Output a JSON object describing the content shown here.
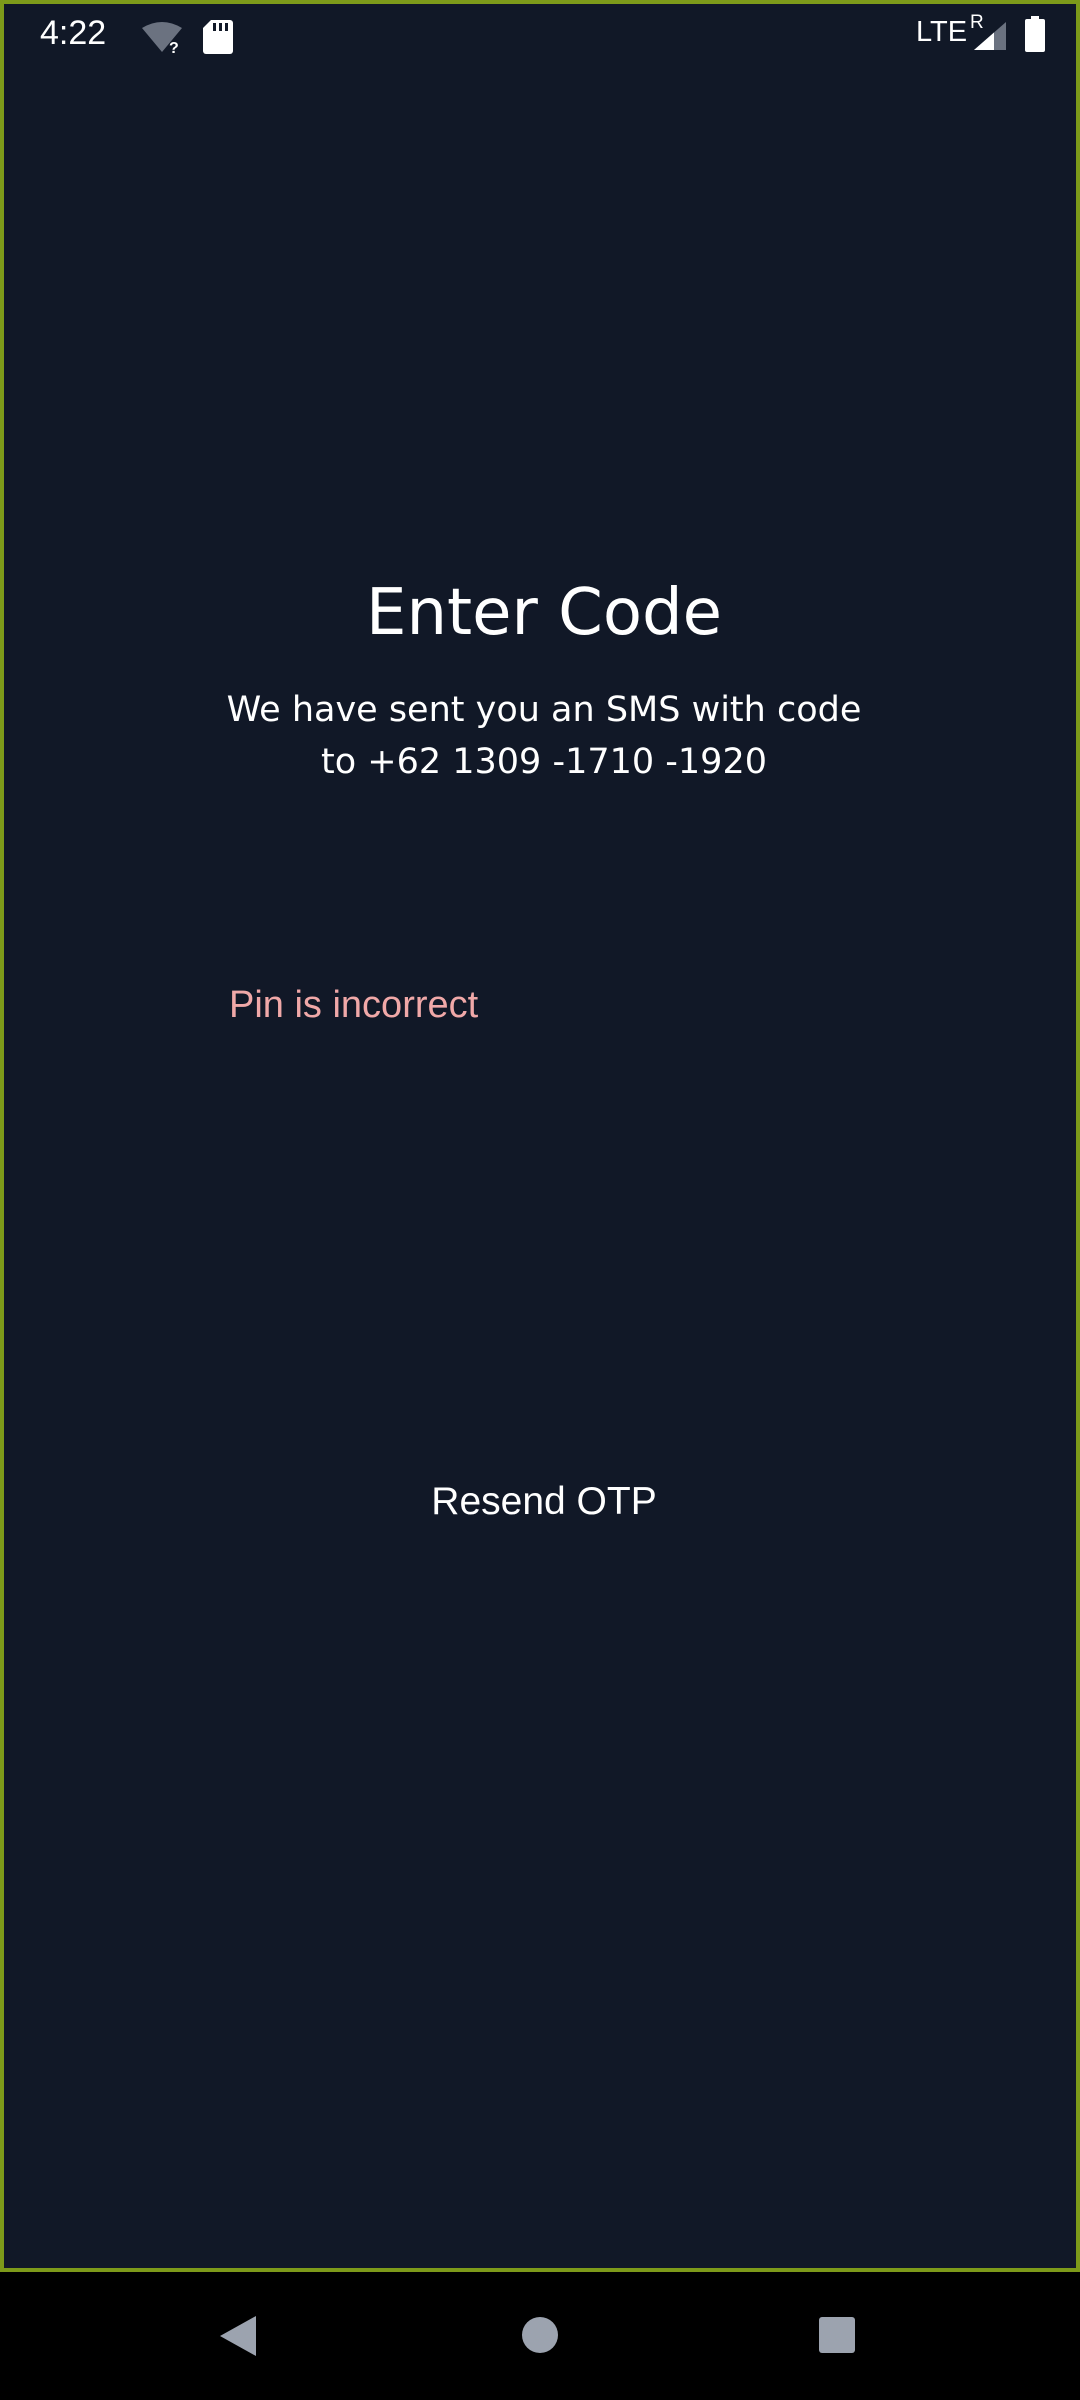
{
  "status_bar": {
    "time": "4:22",
    "network": "LTE",
    "roaming": "R",
    "icons": [
      "wifi-unknown-icon",
      "sd-card-icon",
      "signal-icon",
      "battery-icon"
    ]
  },
  "screen": {
    "title": "Enter Code",
    "subtitle_line1": "We have sent you an SMS with code",
    "subtitle_line2": "to +62 1309 -1710 -1920",
    "error_message": "Pin is incorrect",
    "resend_label": "Resend OTP"
  },
  "nav_bar": {
    "icons": [
      "back-icon",
      "home-icon",
      "recents-icon"
    ]
  },
  "colors": {
    "background": "#111827",
    "frame_border": "#7d9a1a",
    "error": "#f0a8a8",
    "text": "#ffffff"
  }
}
